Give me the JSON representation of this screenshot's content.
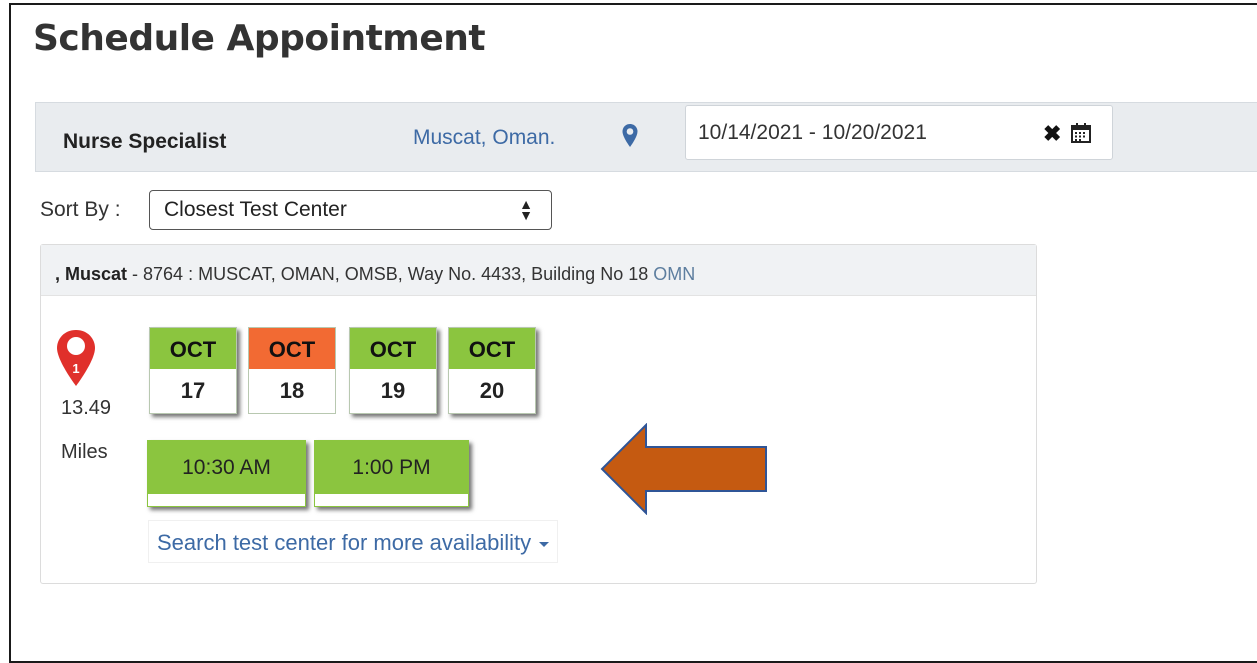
{
  "page": {
    "title": "Schedule Appointment"
  },
  "filter": {
    "exam": "Nurse Specialist",
    "location": "Muscat, Oman.",
    "date_range": "10/14/2021 - 10/20/2021",
    "clear_label": "✖"
  },
  "sort": {
    "label": "Sort By :",
    "selected": "Closest Test Center",
    "arrow": "▲▼"
  },
  "center": {
    "name": ", Muscat",
    "address": " - 8764 : MUSCAT, OMAN, OMSB, Way No. 4433, Building No 18 ",
    "country": "OMN",
    "marker_number": "1",
    "distance": "13.49",
    "distance_unit": "Miles",
    "dates": [
      {
        "month": "OCT",
        "day": "17",
        "selected": false
      },
      {
        "month": "OCT",
        "day": "18",
        "selected": true
      },
      {
        "month": "OCT",
        "day": "19",
        "selected": false
      },
      {
        "month": "OCT",
        "day": "20",
        "selected": false
      }
    ],
    "times": [
      "10:30 AM",
      "1:00 PM"
    ],
    "more_link": "Search test center for more availability"
  },
  "colors": {
    "available": "#8bc53f",
    "selected": "#f26a33",
    "link": "#3d6aa5",
    "marker": "#e0302b",
    "arrow": "#c55a11",
    "arrow_outline": "#2f5597"
  },
  "icons": [
    "map-pin-icon",
    "clear-icon",
    "calendar-icon",
    "map-marker-icon",
    "caret-down-icon",
    "arrow-left-icon"
  ]
}
